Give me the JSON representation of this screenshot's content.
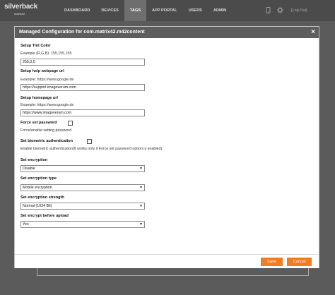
{
  "logo": {
    "line1": "silverback",
    "line2": "matrix42"
  },
  "nav": {
    "items": [
      "DASHBOARD",
      "DEVICES",
      "TAGS",
      "APP PORTAL",
      "USERS",
      "ADMIN"
    ],
    "active": "TAGS"
  },
  "header": {
    "logout_label": "[Log Out]"
  },
  "modal": {
    "title": "Managed Configuration for com.matrix42.m42content",
    "close_glyph": "×",
    "fields": {
      "tint_label": "Setup Tint Color",
      "tint_hint": "Example (R,G,B): 155,155,155",
      "tint_value": "255,0,0",
      "help_label": "Setup help webpage url",
      "help_hint": "Example: https://www.google.de",
      "help_value": "https://support.imagoverum.com",
      "home_label": "Setup homepage url",
      "home_hint": "Example: https://www.google.de",
      "home_value": "https://www.imagoverum.com",
      "force_label": "Force set password",
      "force_hint": "Force/enable setting password",
      "bio_label": "Set biometric authentication",
      "bio_hint": "Enable biometric authentication(It works only if Force set password option is enabled)",
      "enc_label": "Set encryption",
      "enc_value": "Disable",
      "enc_type_label": "Set encryption type",
      "enc_type_value": "Mobile encryption",
      "enc_strength_label": "Set encryption strength",
      "enc_strength_value": "Normal (1024 Bit)",
      "enc_upload_label": "Set encrypt before upload",
      "enc_upload_value": "Yes"
    },
    "footer": {
      "save_label": "Save",
      "cancel_label": "Cancel"
    }
  },
  "colors": {
    "topbar": "#4b4b4b",
    "modal_header": "#5d5d5d",
    "accent": "#f47c20",
    "backdrop": "#5b5b5b"
  },
  "icons": [
    "phone-icon",
    "gear-icon",
    "chevron-down-icon",
    "close-icon"
  ]
}
